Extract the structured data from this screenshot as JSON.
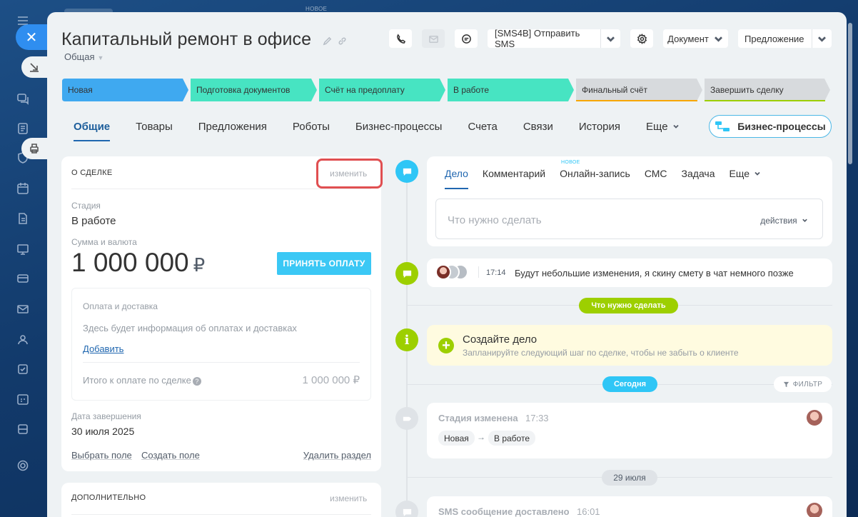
{
  "background": {
    "new_badge": "НОВОЕ"
  },
  "sidebar": {
    "close_icon": "close-icon",
    "floating_buttons": [
      "collapse-icon",
      "print-icon"
    ]
  },
  "header": {
    "title": "Капитальный ремонт в офисе",
    "category": "Общая",
    "sms_button": "[SMS4B] Отправить SMS",
    "document_button": "Документ",
    "proposal_button": "Предложение"
  },
  "stages": [
    {
      "label": "Новая",
      "color": "#3fa9f0"
    },
    {
      "label": "Подготовка документов",
      "color": "#47e4c2"
    },
    {
      "label": "Счёт на предоплату",
      "color": "#47e4c2"
    },
    {
      "label": "В работе",
      "color": "#47e4c2"
    },
    {
      "label": "Финальный счёт",
      "color": "#d7dadd",
      "underline": "#f7a700"
    },
    {
      "label": "Завершить сделку",
      "color": "#d7dadd",
      "underline": "#9dcf00"
    }
  ],
  "tabs": [
    "Общие",
    "Товары",
    "Предложения",
    "Роботы",
    "Бизнес-процессы",
    "Счета",
    "Связи",
    "История",
    "Еще"
  ],
  "bp_button": "Бизнес-процессы",
  "deal_card": {
    "header": "О СДЕЛКЕ",
    "edit": "изменить",
    "stage_label": "Стадия",
    "stage_value": "В работе",
    "sum_label": "Сумма и валюта",
    "amount": "1 000 000",
    "currency": "₽",
    "pay_button": "ПРИНЯТЬ ОПЛАТУ",
    "payment_title": "Оплата и доставка",
    "payment_info": "Здесь будет информация об оплатах и доставках",
    "add_link": "Добавить",
    "total_label": "Итого к оплате по сделке",
    "total_value": "1 000 000 ₽",
    "close_date_label": "Дата завершения",
    "close_date": "30 июля 2025",
    "choose_field": "Выбрать поле",
    "create_field": "Создать поле",
    "delete_section": "Удалить раздел"
  },
  "extra_card": {
    "header": "ДОПОЛНИТЕЛЬНО",
    "edit": "изменить"
  },
  "editor": {
    "tabs": [
      "Дело",
      "Комментарий",
      "Онлайн-запись",
      "СМС",
      "Задача",
      "Еще"
    ],
    "new_badge": "НОВОЕ",
    "placeholder": "Что нужно сделать",
    "actions": "действия"
  },
  "timeline": {
    "comment_time": "17:14",
    "comment_text": "Будут небольшие изменения, я скину смету в чат немного позже",
    "todo_pill": "Что нужно сделать",
    "todo_title": "Создайте дело",
    "todo_subtitle": "Запланируйте следующий шаг по сделке, чтобы не забыть о клиенте",
    "today_pill": "Сегодня",
    "filter": "ФИЛЬТР",
    "stage_change_title": "Стадия изменена",
    "stage_change_time": "17:33",
    "stage_from": "Новая",
    "stage_to": "В работе",
    "date_pill": "29 июля",
    "sms_title": "SMS сообщение доставлено",
    "sms_time": "16:01"
  }
}
